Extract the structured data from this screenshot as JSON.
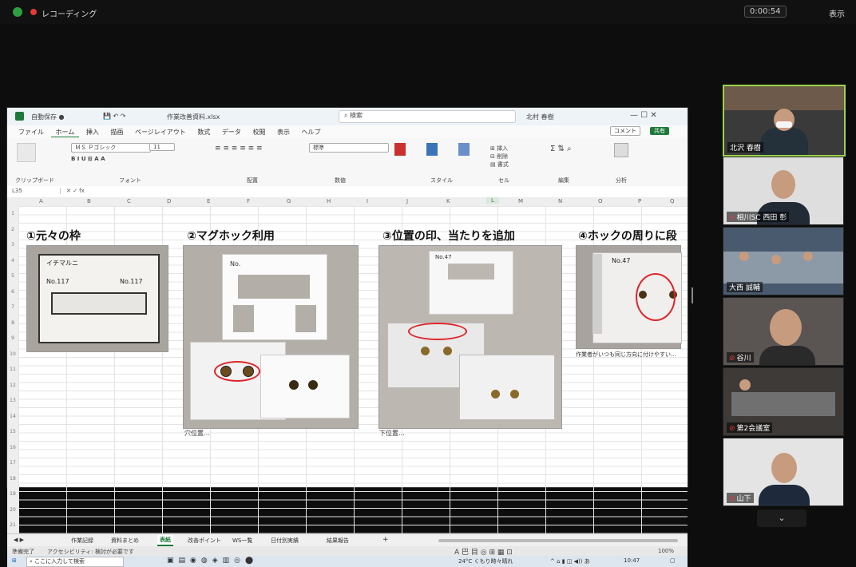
{
  "zoom": {
    "recording_label": "レコーディング",
    "timer": "0:00:54",
    "top_right_label": "表示"
  },
  "excel": {
    "title": "作業改善資料.xlsx",
    "search_placeholder": "検索",
    "user": "北村 春樹",
    "menu": [
      "ファイル",
      "ホーム",
      "挿入",
      "描画",
      "ページレイアウト",
      "数式",
      "データ",
      "校閲",
      "表示",
      "ヘルプ"
    ],
    "comment_btn": "コメント",
    "share_btn": "共有",
    "ribbon_groups": [
      "クリップボード",
      "フォント",
      "配置",
      "数値",
      "スタイル",
      "セル",
      "編集",
      "分析"
    ],
    "font_name": "ＭＳ Ｐゴシック",
    "font_size": "11",
    "number_format": "標準",
    "cell_ref": "L35",
    "columns": [
      "A",
      "B",
      "C",
      "D",
      "E",
      "F",
      "G",
      "H",
      "I",
      "J",
      "K",
      "L",
      "M",
      "N",
      "O",
      "P",
      "Q"
    ],
    "rows": [
      "1",
      "2",
      "3",
      "4",
      "5",
      "6",
      "7",
      "8",
      "9",
      "10",
      "11",
      "12",
      "13",
      "14",
      "15",
      "16",
      "17",
      "18",
      "19",
      "20",
      "21"
    ],
    "sections": [
      {
        "title": "①元々の枠"
      },
      {
        "title": "②マグホック利用",
        "caption": "穴位置…"
      },
      {
        "title": "③位置の印、当たりを追加",
        "caption": "下位置…"
      },
      {
        "title": "④ホックの周りに段",
        "caption": "作業者がいつも同じ方向に付けやすい…"
      }
    ],
    "photo1_texts": [
      "イチマルニ",
      "No.117",
      "No.117"
    ],
    "photo2_texts": [
      "No."
    ],
    "photo3_texts": [
      "No.47"
    ],
    "photo4_texts": [
      "No.47"
    ],
    "sheet_tabs": [
      "作業記録",
      "資料まとめ",
      "表紙",
      "改善ポイント",
      "WS一覧",
      "日付別実績",
      "結果報告"
    ],
    "active_tab": "表紙",
    "status_left": "準備完了",
    "status_accessibility": "アクセシビリティ: 検討が必要です",
    "zoom_level": "100%",
    "taskbar_search": "ここに入力して検索",
    "weather": "24°C くもり時々晴れ",
    "clock": "10:47"
  },
  "participants": [
    {
      "name": "北沢 春樹",
      "muted": false,
      "active": true
    },
    {
      "name": "相川SC 西田 彰",
      "muted": true,
      "active": false
    },
    {
      "name": "大西 誠輔",
      "muted": false,
      "active": false
    },
    {
      "name": "谷川",
      "muted": true,
      "active": false
    },
    {
      "name": "第2会議室",
      "muted": true,
      "active": false
    },
    {
      "name": "山下",
      "muted": true,
      "active": false
    }
  ],
  "colors": {
    "accent_green": "#9bd34a",
    "red_circle": "#e0242a",
    "excel_green": "#1e7a3a"
  }
}
